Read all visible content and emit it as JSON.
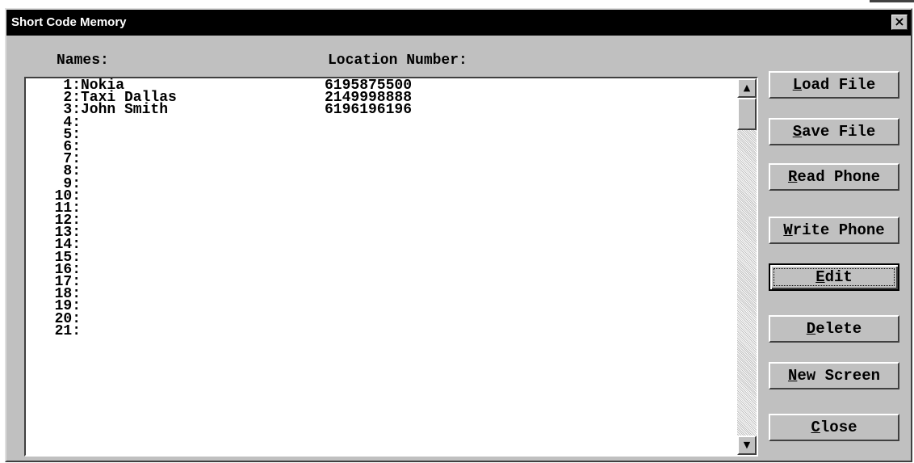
{
  "window": {
    "title": "Short Code Memory",
    "close_glyph": "×"
  },
  "columns": {
    "names": "Names:",
    "location": "Location Number:"
  },
  "rows": [
    {
      "index": "1:",
      "name": "Nokia",
      "number": "6195875500"
    },
    {
      "index": "2:",
      "name": "Taxi Dallas",
      "number": "2149998888"
    },
    {
      "index": "3:",
      "name": "John Smith",
      "number": "6196196196"
    },
    {
      "index": "4:",
      "name": "",
      "number": ""
    },
    {
      "index": "5:",
      "name": "",
      "number": ""
    },
    {
      "index": "6:",
      "name": "",
      "number": ""
    },
    {
      "index": "7:",
      "name": "",
      "number": ""
    },
    {
      "index": "8:",
      "name": "",
      "number": ""
    },
    {
      "index": "9:",
      "name": "",
      "number": ""
    },
    {
      "index": "10:",
      "name": "",
      "number": ""
    },
    {
      "index": "11:",
      "name": "",
      "number": ""
    },
    {
      "index": "12:",
      "name": "",
      "number": ""
    },
    {
      "index": "13:",
      "name": "",
      "number": ""
    },
    {
      "index": "14:",
      "name": "",
      "number": ""
    },
    {
      "index": "15:",
      "name": "",
      "number": ""
    },
    {
      "index": "16:",
      "name": "",
      "number": ""
    },
    {
      "index": "17:",
      "name": "",
      "number": ""
    },
    {
      "index": "18:",
      "name": "",
      "number": ""
    },
    {
      "index": "19:",
      "name": "",
      "number": ""
    },
    {
      "index": "20:",
      "name": "",
      "number": ""
    },
    {
      "index": "21:",
      "name": "",
      "number": ""
    }
  ],
  "scrollbar": {
    "up_glyph": "▲",
    "down_glyph": "▼"
  },
  "buttons": {
    "load_file": {
      "mnemonic": "L",
      "rest": "oad File"
    },
    "save_file": {
      "mnemonic": "S",
      "rest": "ave File"
    },
    "read_phone": {
      "mnemonic": "R",
      "rest": "ead Phone"
    },
    "write_phone": {
      "mnemonic": "W",
      "rest": "rite Phone"
    },
    "edit": {
      "mnemonic": "E",
      "rest": "dit"
    },
    "delete": {
      "mnemonic": "D",
      "rest": "elete"
    },
    "new_screen": {
      "mnemonic": "N",
      "rest": "ew Screen"
    },
    "close": {
      "mnemonic": "C",
      "rest": "lose"
    }
  }
}
